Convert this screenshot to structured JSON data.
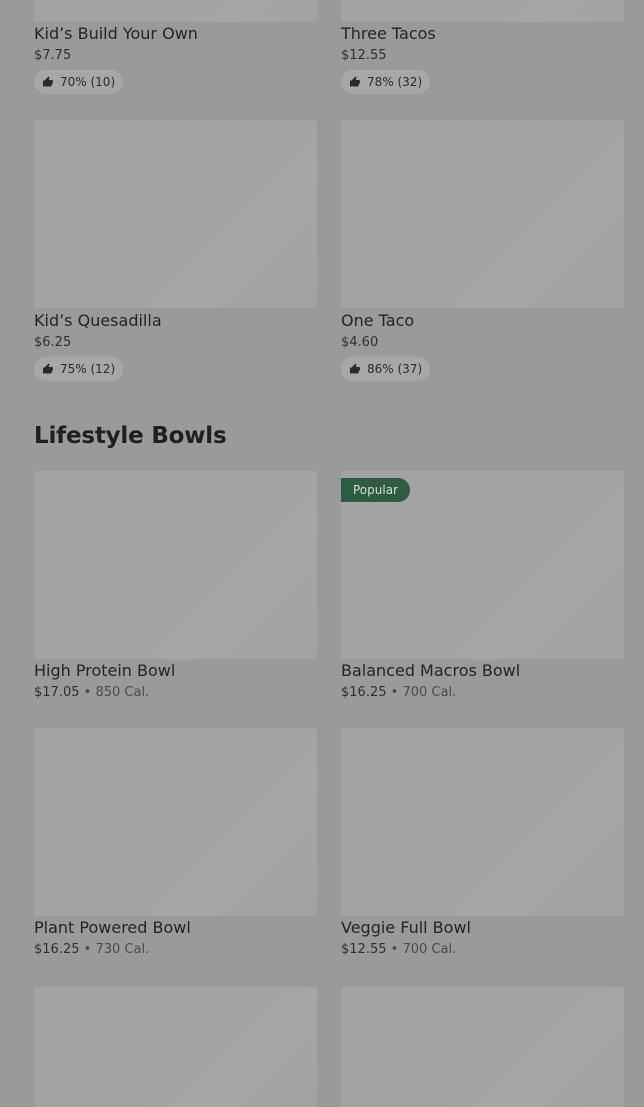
{
  "top_section": {
    "items": [
      {
        "name": "Kid’s Build Your Own",
        "price": "$7.75",
        "rating": "70% (10)"
      },
      {
        "name": "Three Tacos",
        "price": "$12.55",
        "rating": "78% (32)"
      },
      {
        "name": "Kid’s Quesadilla",
        "price": "$6.25",
        "rating": "75% (12)"
      },
      {
        "name": "One Taco",
        "price": "$4.60",
        "rating": "86% (37)"
      }
    ]
  },
  "lifestyle": {
    "title": "Lifestyle Bowls",
    "items": [
      {
        "name": "High Protein Bowl",
        "price": "$17.05",
        "separator": "•",
        "calories": "850 Cal."
      },
      {
        "name": "Balanced Macros Bowl",
        "price": "$16.25",
        "separator": "•",
        "calories": "700 Cal.",
        "badge": "Popular"
      },
      {
        "name": "Plant Powered Bowl",
        "price": "$16.25",
        "separator": "•",
        "calories": "730 Cal."
      },
      {
        "name": "Veggie Full Bowl",
        "price": "$12.55",
        "separator": "•",
        "calories": "700 Cal."
      }
    ]
  },
  "colors": {
    "badge_bg": "#2d5c43",
    "placeholder": "#a3a3a3",
    "background": "#9a9a9a"
  }
}
